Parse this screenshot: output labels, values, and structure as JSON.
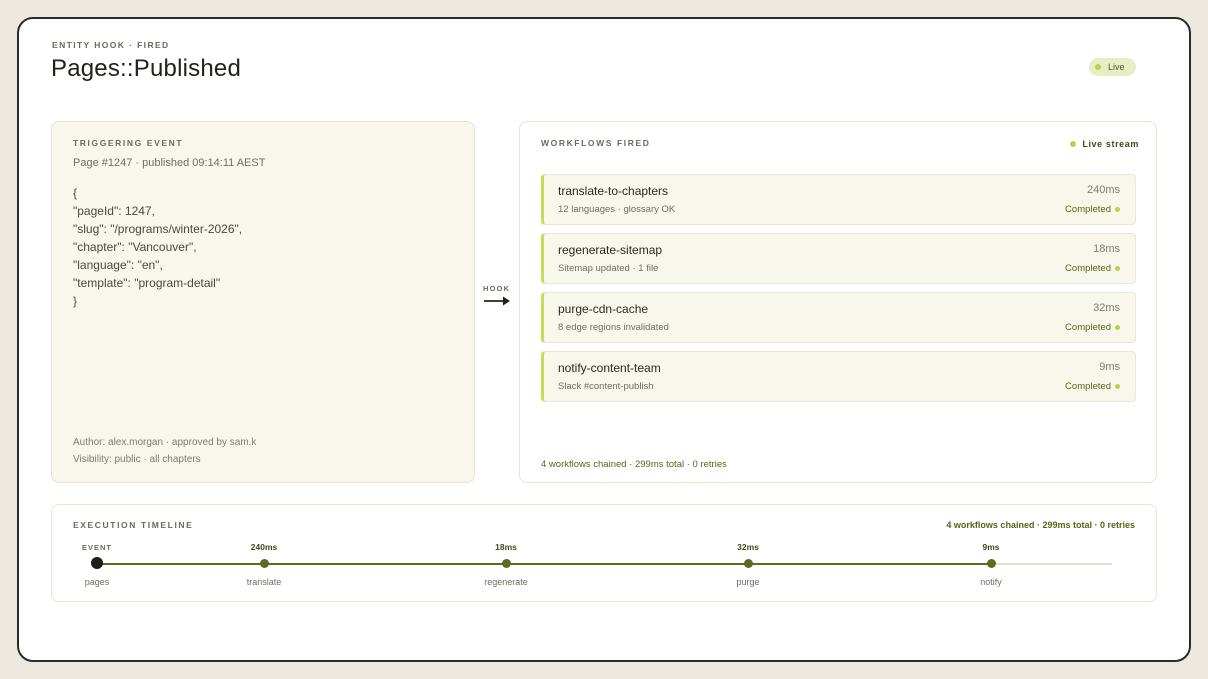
{
  "header": {
    "eyebrow": "ENTITY HOOK · FIRED",
    "title": "Pages::Published",
    "live_label": "Live"
  },
  "colors": {
    "accent": "#c8dc5a",
    "status_green": "#b7d34a",
    "timeline_line": "#5b6b22"
  },
  "trigger": {
    "title": "TRIGGERING EVENT",
    "subtitle": "Page #1247 · published 09:14:11 AEST",
    "code_lines": [
      "{",
      "\"pageId\": 1247,",
      "\"slug\": \"/programs/winter-2026\",",
      "\"chapter\": \"Vancouver\",",
      "\"language\": \"en\",",
      "\"template\": \"program-detail\"",
      "}"
    ],
    "author": "Author: alex.morgan · approved by sam.k",
    "visibility": "Visibility: public · all chapters"
  },
  "hook": {
    "label": "HOOK",
    "icon": "arrow-right-icon"
  },
  "workflows": {
    "title": "WORKFLOWS FIRED",
    "stream_label": "Live stream",
    "items": [
      {
        "name": "translate-to-chapters",
        "time": "240ms",
        "desc": "12 languages · glossary OK",
        "status": "Completed"
      },
      {
        "name": "regenerate-sitemap",
        "time": "18ms",
        "desc": "Sitemap updated · 1 file",
        "status": "Completed"
      },
      {
        "name": "purge-cdn-cache",
        "time": "32ms",
        "desc": "8 edge regions invalidated",
        "status": "Completed"
      },
      {
        "name": "notify-content-team",
        "time": "9ms",
        "desc": "Slack #content-publish",
        "status": "Completed"
      }
    ],
    "summary": "4 workflows chained · 299ms total · 0 retries"
  },
  "timeline": {
    "title": "EXECUTION TIMELINE",
    "summary": "4 workflows chained · 299ms total · 0 retries",
    "steps": [
      {
        "top": "EVENT",
        "bottom": "pages"
      },
      {
        "top": "240ms",
        "bottom": "translate"
      },
      {
        "top": "18ms",
        "bottom": "regenerate"
      },
      {
        "top": "32ms",
        "bottom": "purge"
      },
      {
        "top": "9ms",
        "bottom": "notify"
      }
    ]
  }
}
